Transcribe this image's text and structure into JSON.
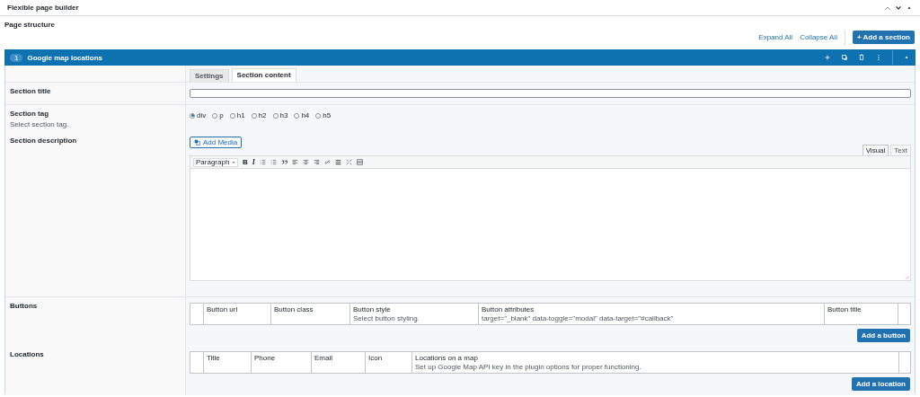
{
  "panel": {
    "title": "Flexible page builder",
    "subtitle": "Page structure"
  },
  "actions": {
    "expand": "Expand All",
    "collapse": "Collapse All",
    "add": "+ Add a section"
  },
  "section": {
    "number": "1",
    "title": "Google map locations",
    "expanded": true
  },
  "tabs": [
    {
      "label": "Settings",
      "selected": false
    },
    {
      "label": "Section content",
      "selected": true
    }
  ],
  "fields": {
    "title": {
      "label": "Section title"
    },
    "tag": {
      "label": "Section tag",
      "hint": "Select section tag.",
      "options": [
        {
          "label": "div",
          "selected": true
        },
        {
          "label": "p",
          "selected": false
        },
        {
          "label": "h1",
          "selected": false
        },
        {
          "label": "h2",
          "selected": false
        },
        {
          "label": "h3",
          "selected": false
        },
        {
          "label": "h4",
          "selected": false
        },
        {
          "label": "h5",
          "selected": false
        }
      ]
    },
    "description": {
      "label": "Section description",
      "media": "Add Media",
      "format": "Paragraph",
      "bold": "B",
      "italic": "I",
      "modes": [
        {
          "label": "Visual",
          "selected": true
        },
        {
          "label": "Text",
          "selected": false
        }
      ]
    },
    "buttons": {
      "label": "Buttons",
      "columns": [
        {
          "label": "Button url"
        },
        {
          "label": "Button class"
        },
        {
          "label": "Button style",
          "hint": "Select button styling."
        },
        {
          "label": "Button attributes",
          "hint": "target=\"_blank\" data-toggle=\"modal\" data-target=\"#callback\""
        },
        {
          "label": "Button title"
        }
      ],
      "add": "Add a button"
    },
    "locations": {
      "label": "Locations",
      "columns": [
        {
          "label": "Title"
        },
        {
          "label": "Phone"
        },
        {
          "label": "Email"
        },
        {
          "label": "Icon"
        },
        {
          "label": "Locations on a map",
          "hint": "Set up Google Map API key in the plugin options for proper functioning."
        }
      ],
      "add": "Add a location"
    }
  }
}
